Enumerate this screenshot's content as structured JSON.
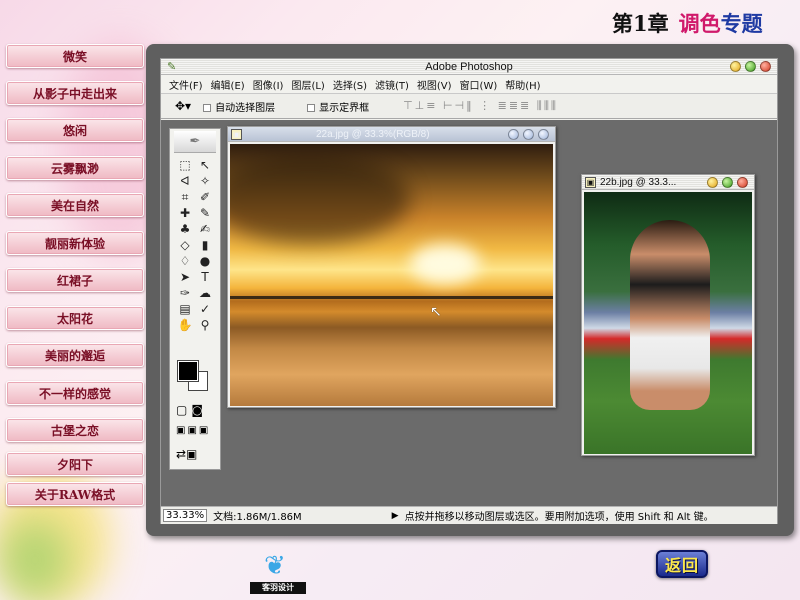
{
  "header": {
    "chapter": "第1章",
    "topic_a": "调色",
    "topic_b": "专题"
  },
  "nav": [
    "微笑",
    "从影子中走出来",
    "悠闲",
    "云雾飘渺",
    "美在自然",
    "靓丽新体验",
    "红裙子",
    "太阳花",
    "美丽的邂逅",
    "不一样的感觉",
    "古堡之恋",
    "夕阳下",
    "关于RAW格式"
  ],
  "app": {
    "title": "Adobe Photoshop",
    "menus": [
      "文件(F)",
      "编辑(E)",
      "图像(I)",
      "图层(L)",
      "选择(S)",
      "滤镜(T)",
      "视图(V)",
      "窗口(W)",
      "帮助(H)"
    ],
    "options": {
      "auto_select": "自动选择图层",
      "show_bounds": "显示定界框"
    },
    "doc1_title": "22a.jpg @ 33.3%(RGB/8)",
    "doc2_title": "22b.jpg @ 33.3...",
    "status": {
      "zoom": "33.33%",
      "doc_size": "文档:1.86M/1.86M",
      "hint": "点按并拖移以移动图层或选区。要用附加选项，使用 Shift 和 Alt 键。"
    }
  },
  "footer": {
    "return": "返回",
    "logo_text": "客羽设计"
  },
  "colors": {
    "accent_pink": "#d0196b",
    "accent_blue": "#1f3aa3",
    "nav_text": "#7a0f26"
  }
}
